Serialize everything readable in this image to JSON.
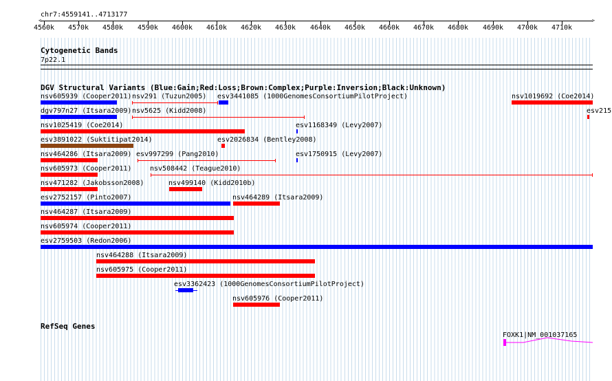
{
  "position_label": "chr7:4559141..4713177",
  "ruler": {
    "ticks": [
      "4560k",
      "4570k",
      "4580k",
      "4590k",
      "4600k",
      "4610k",
      "4620k",
      "4630k",
      "4640k",
      "4650k",
      "4660k",
      "4670k",
      "4680k",
      "4690k",
      "4700k",
      "4710k"
    ]
  },
  "cytoband": {
    "title": "Cytogenetic Bands",
    "band": "7p22.1"
  },
  "dgv": {
    "title": "DGV Structural Variants (Blue:Gain;Red:Loss;Brown:Complex;Purple:Inversion;Black:Unknown)",
    "colors": {
      "gain": "#0000ff",
      "loss": "#ff0000",
      "complex": "#8b4513",
      "inversion": "#800080",
      "unknown": "#000000"
    },
    "variants": [
      {
        "label": "nsv605939 (Cooper2011)",
        "type": "gain"
      },
      {
        "label": "nsv291 (Tuzun2005)",
        "type": "loss"
      },
      {
        "label": "esv3441085 (1000GenomesConsortiumPilotProject)",
        "type": "gain"
      },
      {
        "label": "nsv1019692 (Coe2014)",
        "type": "loss"
      },
      {
        "label": "dgv797n27 (Itsara2009)",
        "type": "gain"
      },
      {
        "label": "nsv5625 (Kidd2008)",
        "type": "loss"
      },
      {
        "label": "esv215",
        "type": "loss"
      },
      {
        "label": "nsv1025419 (Coe2014)",
        "type": "loss"
      },
      {
        "label": "esv1168349 (Levy2007)",
        "type": "gain"
      },
      {
        "label": "esv3891022 (Suktitipat2014)",
        "type": "complex"
      },
      {
        "label": "esv2026834 (Bentley2008)",
        "type": "loss"
      },
      {
        "label": "nsv464286 (Itsara2009)",
        "type": "loss"
      },
      {
        "label": "esv997299 (Pang2010)",
        "type": "loss"
      },
      {
        "label": "esv1750915 (Levy2007)",
        "type": "gain"
      },
      {
        "label": "nsv605973 (Cooper2011)",
        "type": "loss"
      },
      {
        "label": "nsv508442 (Teague2010)",
        "type": "loss"
      },
      {
        "label": "nsv471282 (Jakobsson2008)",
        "type": "loss"
      },
      {
        "label": "nsv499140 (Kidd2010b)",
        "type": "loss"
      },
      {
        "label": "esv2752157 (Pinto2007)",
        "type": "gain"
      },
      {
        "label": "nsv464289 (Itsara2009)",
        "type": "loss"
      },
      {
        "label": "nsv464287 (Itsara2009)",
        "type": "loss"
      },
      {
        "label": "nsv605974 (Cooper2011)",
        "type": "loss"
      },
      {
        "label": "esv2759503 (Redon2006)",
        "type": "gain"
      },
      {
        "label": "nsv464288 (Itsara2009)",
        "type": "loss"
      },
      {
        "label": "nsv605975 (Cooper2011)",
        "type": "loss"
      },
      {
        "label": "esv3362423 (1000GenomesConsortiumPilotProject)",
        "type": "gain"
      },
      {
        "label": "nsv605976 (Cooper2011)",
        "type": "loss"
      }
    ]
  },
  "refseq": {
    "title": "RefSeq Genes",
    "gene_label": "FOXK1|NM_001037165",
    "color": "#ff00ff"
  }
}
